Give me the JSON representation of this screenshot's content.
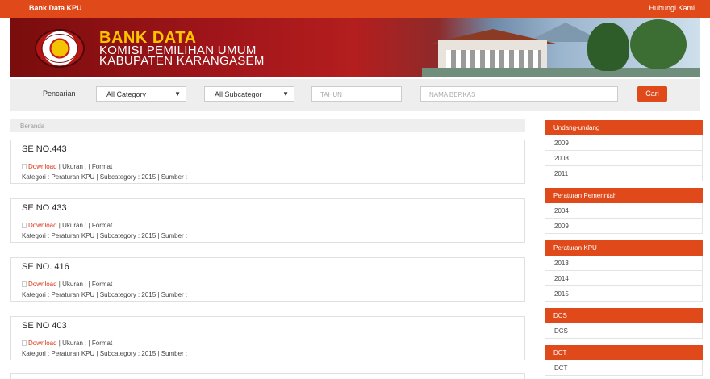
{
  "topbar": {
    "brand": "Bank Data KPU",
    "contact": "Hubungi Kami"
  },
  "banner": {
    "title": "BANK DATA",
    "line1": "KOMISI PEMILIHAN UMUM",
    "line2": "KABUPATEN KARANGASEM",
    "logo_text": "KOMISI PEMILIHAN UMUM"
  },
  "search": {
    "label": "Pencarian",
    "category": "All Category",
    "subcategory": "All Subcategor",
    "tahun_placeholder": "TAHUN",
    "nama_placeholder": "NAMA BERKAS",
    "button": "Cari"
  },
  "breadcrumb": "Beranda",
  "documents": [
    {
      "title": "SE NO.443",
      "download": "Download",
      "meta": " | Ukuran : | Format :",
      "kategori": "Kategori : Peraturan KPU | Subcategory : 2015 | Sumber :"
    },
    {
      "title": "SE NO 433",
      "download": "Download",
      "meta": " | Ukuran : | Format :",
      "kategori": "Kategori : Peraturan KPU | Subcategory : 2015 | Sumber :"
    },
    {
      "title": "SE NO. 416",
      "download": "Download",
      "meta": " | Ukuran : | Format :",
      "kategori": "Kategori : Peraturan KPU | Subcategory : 2015 | Sumber :"
    },
    {
      "title": "SE NO 403",
      "download": "Download",
      "meta": " | Ukuran : | Format :",
      "kategori": "Kategori : Peraturan KPU | Subcategory : 2015 | Sumber :"
    }
  ],
  "sidebar": [
    {
      "heading": "Undang-undang",
      "items": [
        "2009",
        "2008",
        "2011"
      ]
    },
    {
      "heading": "Peraturan Pemerintah",
      "items": [
        "2004",
        "2009"
      ]
    },
    {
      "heading": "Peraturan KPU",
      "items": [
        "2013",
        "2014",
        "2015"
      ]
    },
    {
      "heading": "DCS",
      "items": [
        "DCS"
      ]
    },
    {
      "heading": "DCT",
      "items": [
        "DCT"
      ]
    }
  ],
  "colors": {
    "accent": "#e04a1a",
    "link": "#d9361a",
    "panel": "#eeeeee"
  },
  "icons": {
    "dropdown": "caret-down-icon",
    "download": "checkbox-icon"
  }
}
